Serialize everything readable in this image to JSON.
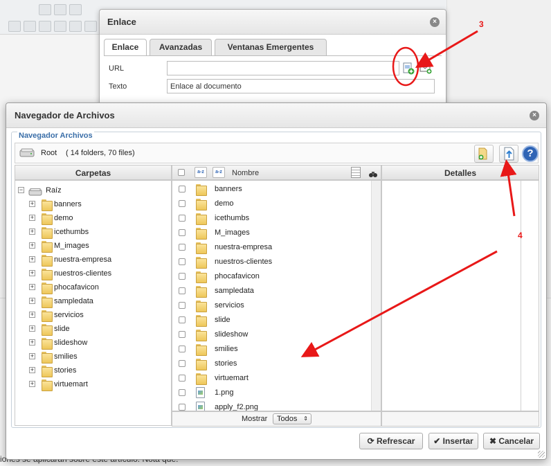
{
  "link_dialog": {
    "title": "Enlace",
    "tabs": [
      {
        "label": "Enlace"
      },
      {
        "label": "Avanzadas"
      },
      {
        "label": "Ventanas Emergentes"
      }
    ],
    "url_label": "URL",
    "url_value": "",
    "text_label": "Texto",
    "text_value": "Enlace al documento"
  },
  "browser_dialog": {
    "title": "Navegador de Archivos",
    "legend": "Navegador Archivos",
    "root_label": "Root",
    "root_count": "( 14 folders, 70 files)",
    "columns": {
      "folders": "Carpetas",
      "name": "Nombre",
      "details": "Detalles"
    },
    "tree_root": "Raíz",
    "folders": [
      "banners",
      "demo",
      "icethumbs",
      "M_images",
      "nuestra-empresa",
      "nuestros-clientes",
      "phocafavicon",
      "sampledata",
      "servicios",
      "slide",
      "slideshow",
      "smilies",
      "stories",
      "virtuemart"
    ],
    "files": [
      {
        "name": "banners",
        "type": "folder"
      },
      {
        "name": "demo",
        "type": "folder"
      },
      {
        "name": "icethumbs",
        "type": "folder"
      },
      {
        "name": "M_images",
        "type": "folder"
      },
      {
        "name": "nuestra-empresa",
        "type": "folder"
      },
      {
        "name": "nuestros-clientes",
        "type": "folder"
      },
      {
        "name": "phocafavicon",
        "type": "folder"
      },
      {
        "name": "sampledata",
        "type": "folder"
      },
      {
        "name": "servicios",
        "type": "folder"
      },
      {
        "name": "slide",
        "type": "folder"
      },
      {
        "name": "slideshow",
        "type": "folder"
      },
      {
        "name": "smilies",
        "type": "folder"
      },
      {
        "name": "stories",
        "type": "folder"
      },
      {
        "name": "virtuemart",
        "type": "folder"
      },
      {
        "name": "1.png",
        "type": "file"
      },
      {
        "name": "apply_f2.png",
        "type": "file"
      }
    ],
    "show_label": "Mostrar",
    "show_value": "Todos",
    "buttons": {
      "refresh": "Refrescar",
      "insert": "Insertar",
      "cancel": "Cancelar"
    }
  },
  "annotations": {
    "n3": "3",
    "n4": "4"
  },
  "background_text": "iones se aplicarán sobre este artículo. Nota que:",
  "colors": {
    "accent_blue": "#3a6ea8",
    "annotation_red": "#e81818",
    "help_blue": "#2f64b5"
  }
}
